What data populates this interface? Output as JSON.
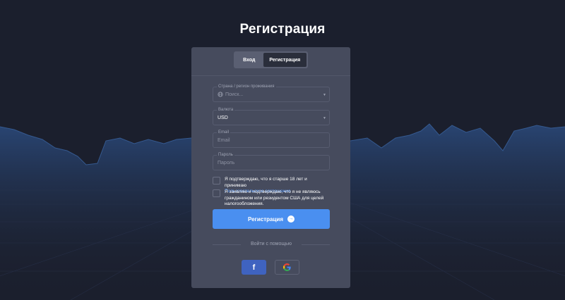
{
  "page": {
    "title": "Регистрация"
  },
  "tabs": [
    {
      "label": "Вход",
      "active": false
    },
    {
      "label": "Регистрация",
      "active": true
    }
  ],
  "form": {
    "country": {
      "label": "Страна / регион проживания",
      "placeholder": "Поиск..."
    },
    "currency": {
      "label": "Валюта",
      "value": "USD"
    },
    "email": {
      "label": "Email",
      "placeholder": "Email"
    },
    "password": {
      "label": "Пароль",
      "placeholder": "Пароль"
    },
    "checkbox_age": {
      "text": "Я подтверждаю, что я старше 18 лет и принимаю",
      "link": "Пользовательское соглашение"
    },
    "checkbox_us": {
      "text": "Я заявляю и подтверждаю, что я не являюсь гражданином или резидентом США для целей налогообложения."
    },
    "submit_label": "Регистрация"
  },
  "social": {
    "divider_text": "Войти с помощью",
    "facebook_icon": "facebook-icon",
    "google_icon": "google-icon"
  },
  "colors": {
    "background": "#1b1f2d",
    "card": "#464b5d",
    "accent": "#4a8ff0",
    "link": "#5a9cff",
    "facebook": "#3f63c0"
  }
}
